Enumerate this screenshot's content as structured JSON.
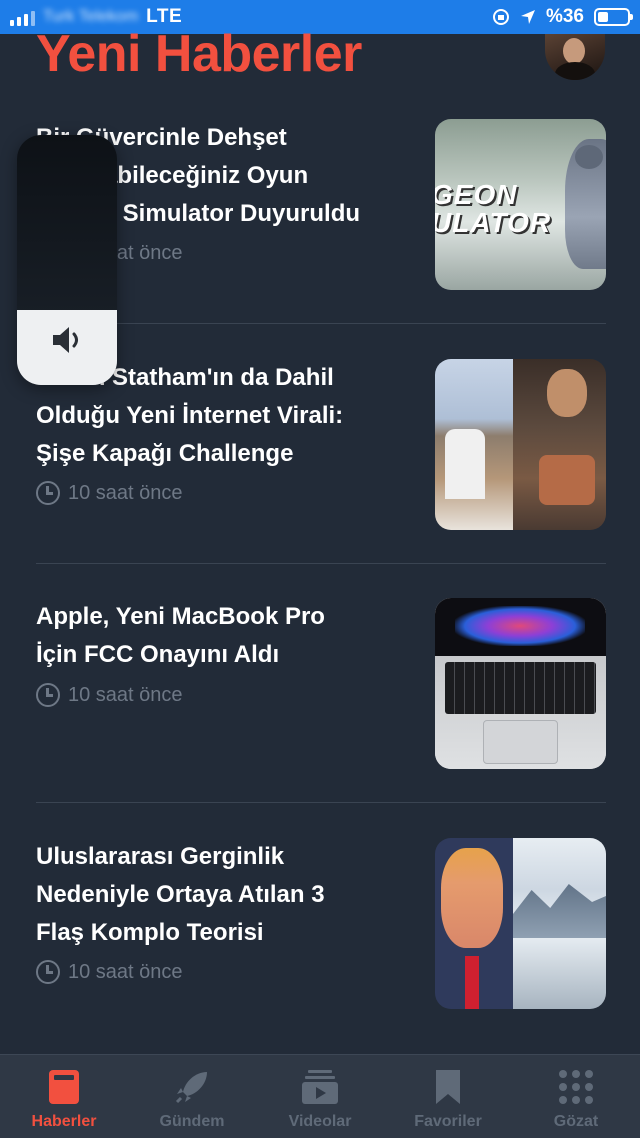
{
  "status_bar": {
    "carrier": "Turk Telekom",
    "network": "LTE",
    "battery": "%36",
    "battery_level": 0.36
  },
  "header": {
    "title": "Yeni Haberler"
  },
  "news": [
    {
      "title_lines": [
        "Bir Güvercinle Dehşet",
        "Yaşayabileceğiniz Oyun",
        "Pigeon Simulator Duyuruldu"
      ],
      "time": "10 saat önce",
      "thumb_text": [
        "GEON",
        "ULATOR"
      ]
    },
    {
      "title_lines": [
        "Jason Statham'ın da Dahil",
        "Olduğu Yeni İnternet Virali:",
        "Şişe Kapağı Challenge"
      ],
      "time": "10 saat önce"
    },
    {
      "title_lines": [
        "Apple, Yeni MacBook Pro",
        "İçin FCC Onayını Aldı"
      ],
      "time": "10 saat önce"
    },
    {
      "title_lines": [
        "Uluslararası Gerginlik",
        "Nedeniyle Ortaya Atılan 3",
        "Flaş Komplo Teorisi"
      ],
      "time": "10 saat önce"
    }
  ],
  "volume_hud": {
    "level": 0.3
  },
  "tab_bar": {
    "tabs": [
      {
        "label": "Haberler",
        "icon": "news-icon",
        "active": true
      },
      {
        "label": "Gündem",
        "icon": "rocket-icon",
        "active": false
      },
      {
        "label": "Videolar",
        "icon": "video-icon",
        "active": false
      },
      {
        "label": "Favoriler",
        "icon": "bookmark-icon",
        "active": false
      },
      {
        "label": "Gözat",
        "icon": "grid-icon",
        "active": false
      }
    ]
  },
  "colors": {
    "accent": "#f2503f",
    "background": "#222b38",
    "status_bar": "#1e7de8",
    "muted": "#6e7886"
  }
}
